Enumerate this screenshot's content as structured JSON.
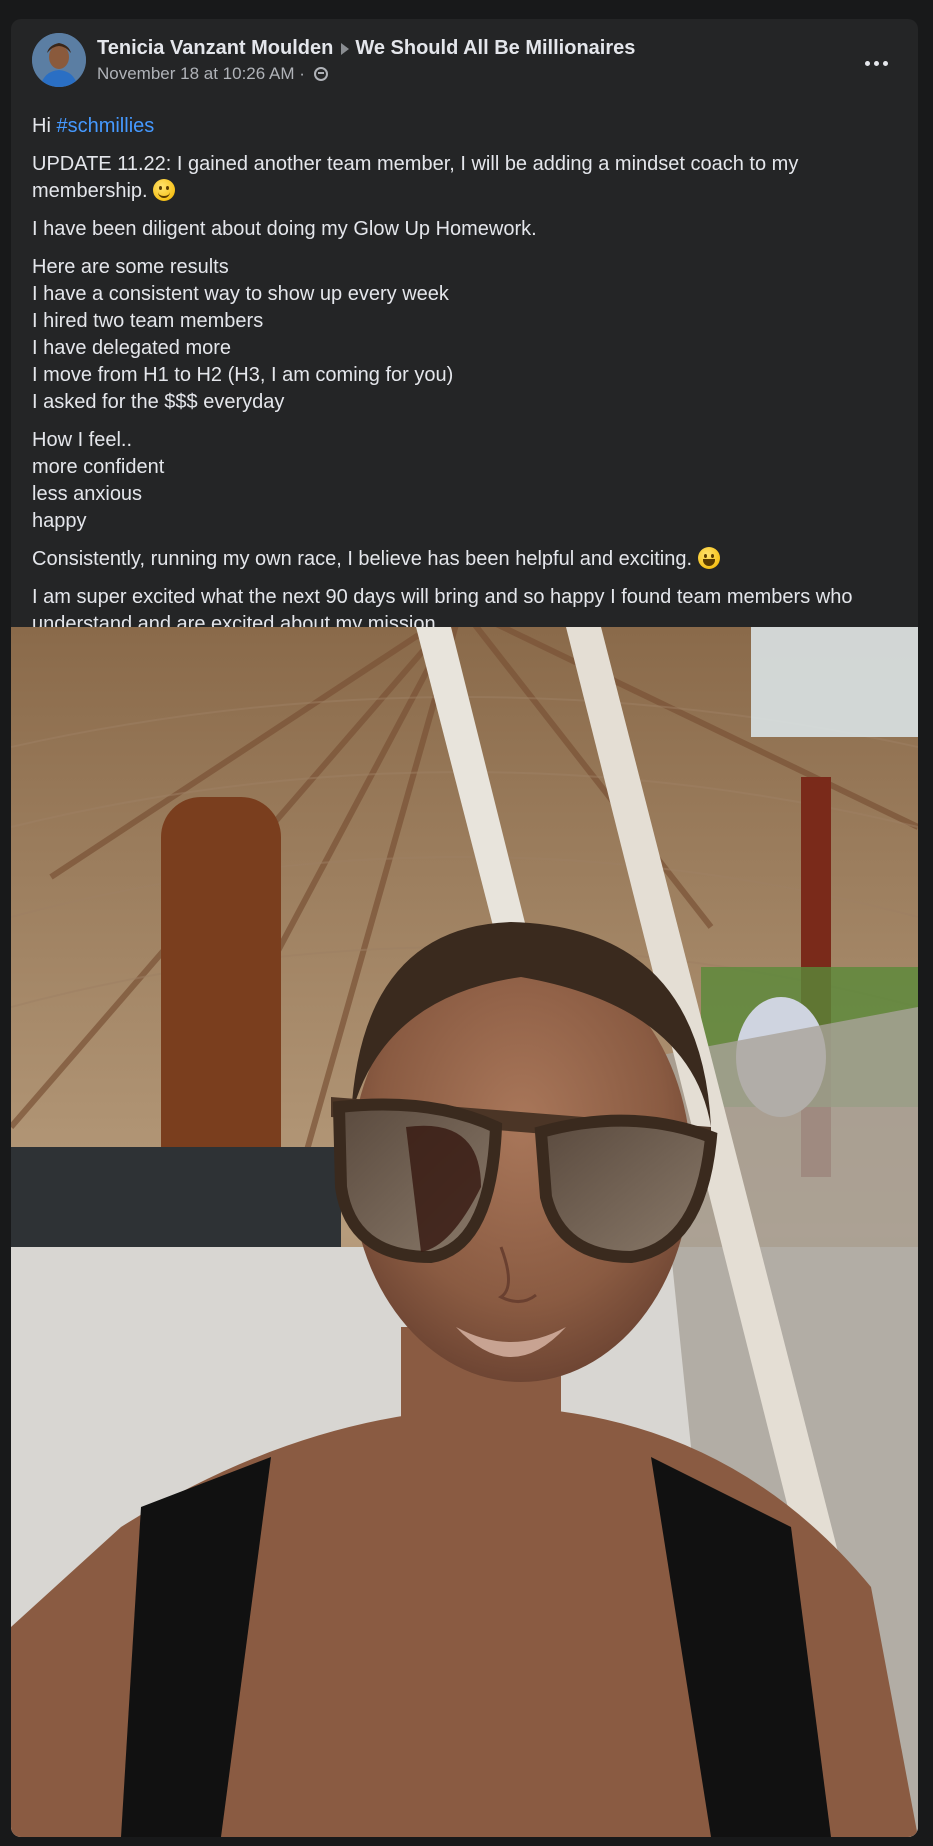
{
  "post": {
    "author": "Tenicia Vanzant Moulden",
    "group": "We Should All Be Millionaires",
    "timestamp": "November 18 at 10:26 AM",
    "separator": "·",
    "body": {
      "greeting": "Hi ",
      "hashtag": "#schmillies",
      "update": "UPDATE 11.22: I gained another team member, I will be adding a mindset coach to my membership.",
      "diligent": "I have been diligent about doing my Glow Up Homework.",
      "results": [
        "Here are some results",
        "I have a consistent way to show up every week",
        "I hired two team members",
        "I have delegated more",
        "I move from H1 to H2 (H3, I am coming for you)",
        "I asked for the $$$ everyday"
      ],
      "feelings": [
        "How I feel..",
        "more confident",
        "less anxious",
        "happy"
      ],
      "race": "Consistently, running my own race, I believe has been helpful and exciting.",
      "closing": "I am super excited what the next 90 days will bring and so happy I found team members who understand and are excited about my mission."
    },
    "icons": {
      "more": "more-options-icon",
      "audience": "group-audience-icon",
      "arrow": "shared-to-arrow-icon",
      "emoji_smirk": "smirking-face-emoji",
      "emoji_grin": "grinning-face-emoji"
    }
  },
  "colors": {
    "background": "#18191a",
    "card": "#242526",
    "text_primary": "#e4e6eb",
    "text_secondary": "#b0b3b8",
    "hashtag": "#4599ff"
  }
}
